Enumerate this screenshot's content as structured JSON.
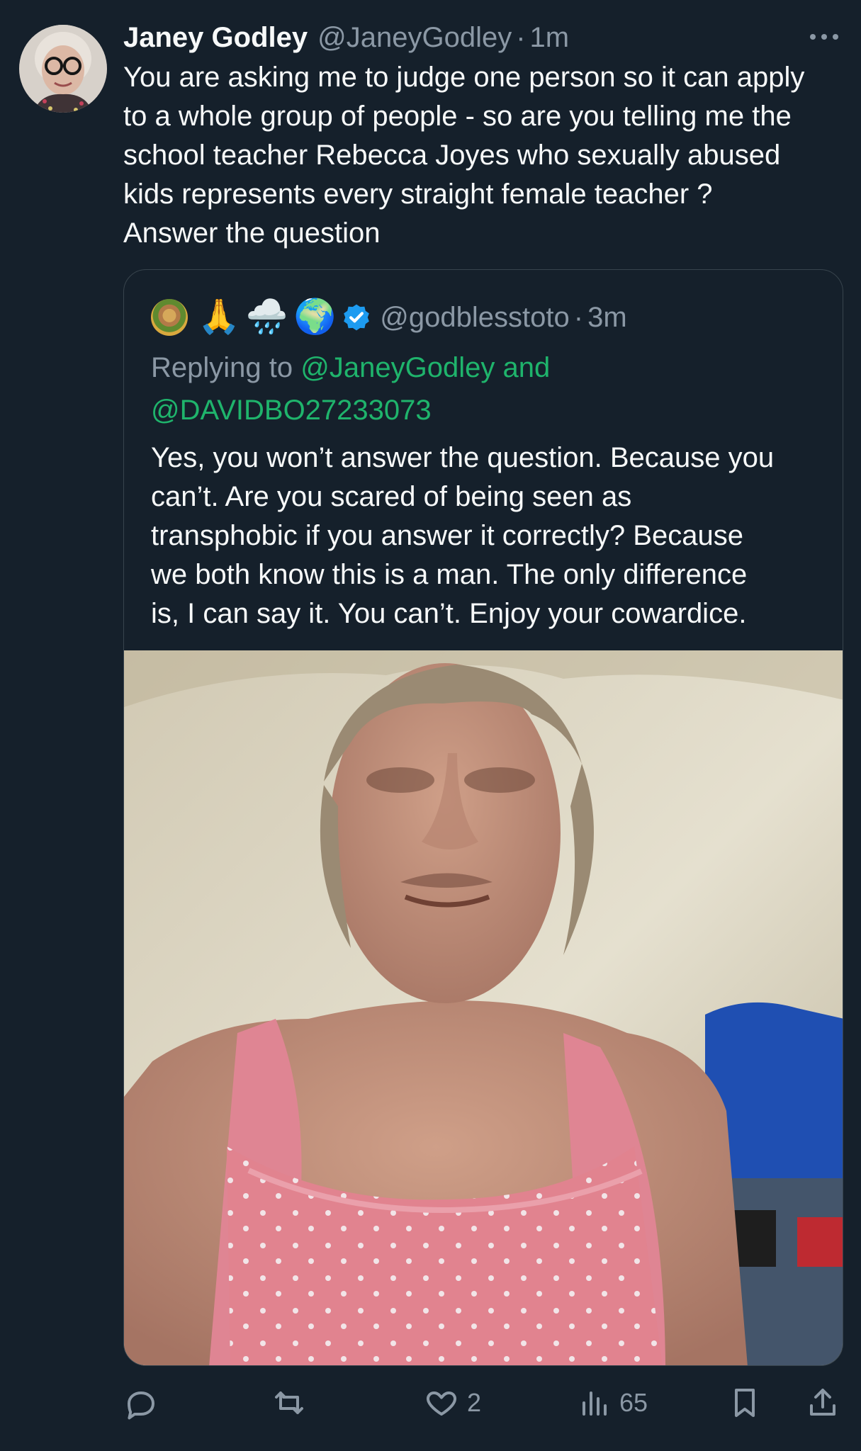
{
  "tweet": {
    "author_name": "Janey Godley",
    "author_handle": "@JaneyGodley",
    "separator": "·",
    "time": "1m",
    "more_icon": "more-horizontal-icon",
    "text_lines": [
      "You are asking me to judge one person so it can apply",
      "to a whole group of people - so are you telling me the",
      "school teacher Rebecca Joyes who sexually abused",
      "kids represents every straight female teacher  ?",
      "Answer the question"
    ]
  },
  "quote": {
    "emojis": [
      "🙏",
      "🌧️",
      "🌍"
    ],
    "verified_icon": "verified-badge-icon",
    "handle": "@godblesstoto",
    "separator": "·",
    "time": "3m",
    "replying_label": "Replying to",
    "reply_handle_1": "@JaneyGodley",
    "reply_join": "and",
    "reply_handle_2": "@DAVIDBO27233073",
    "text_lines": [
      "Yes, you won’t answer the question. Because you",
      "can’t. Are you scared of being seen as",
      "transphobic if you answer it correctly? Because",
      "we both know this is a man. The only difference",
      "is, I can say it. You can’t. Enjoy your cowardice."
    ]
  },
  "actions": {
    "reply_icon": "reply-icon",
    "repost_icon": "repost-icon",
    "like_icon": "heart-icon",
    "like_count": "2",
    "views_icon": "bar-chart-icon",
    "views_count": "65",
    "bookmark_icon": "bookmark-icon",
    "share_icon": "share-icon"
  },
  "colors": {
    "background": "#15202b",
    "primary_text": "#f7f9f9",
    "secondary_text": "#8b98a5",
    "mention": "#1fb46c",
    "border": "#38444d",
    "verified": "#1d9bf0"
  }
}
